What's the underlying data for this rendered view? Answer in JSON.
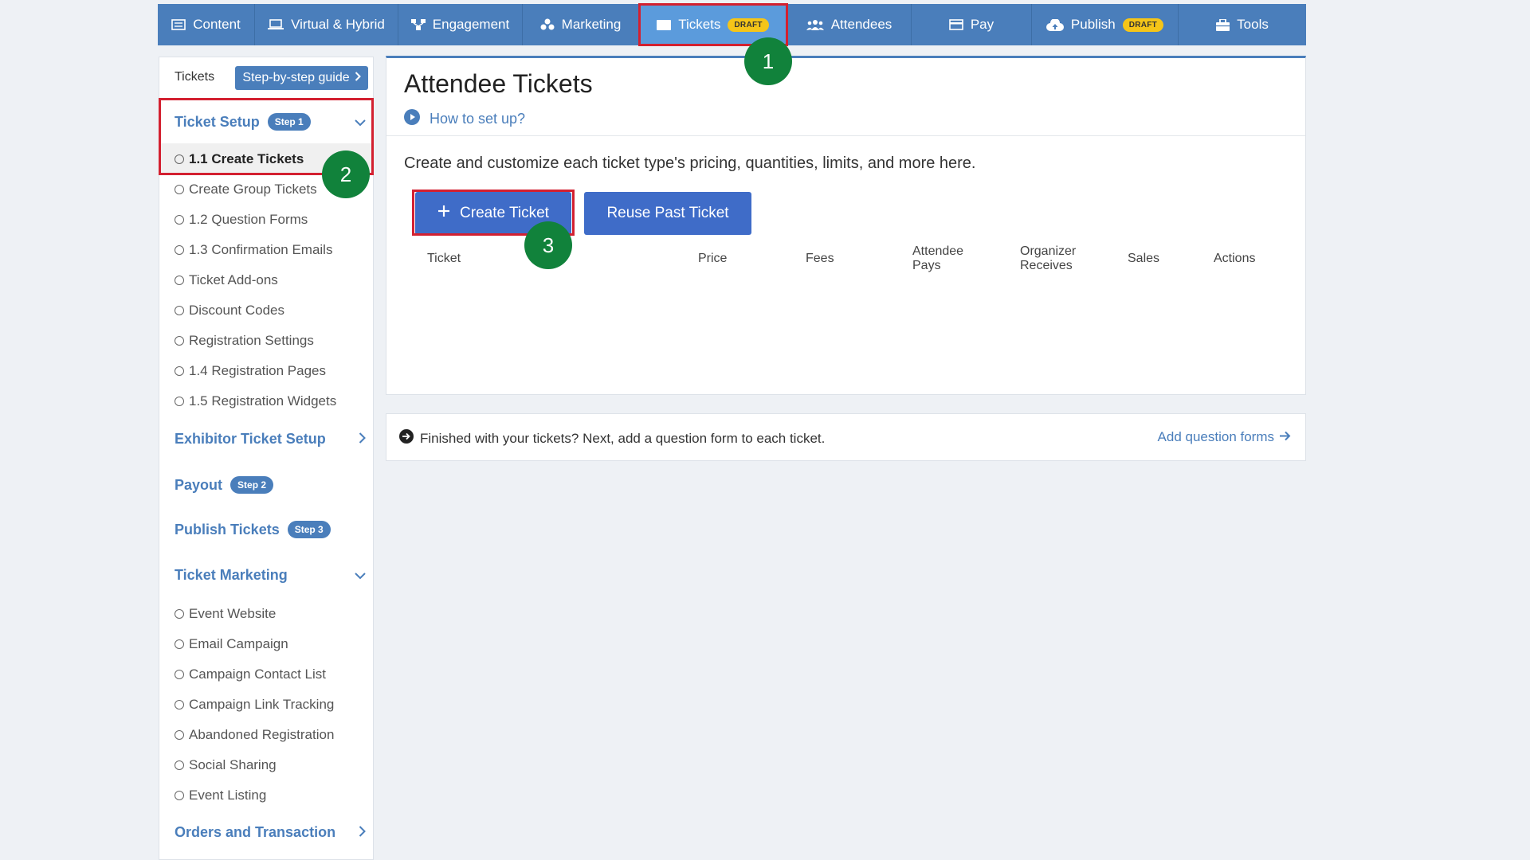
{
  "nav": {
    "items": [
      {
        "label": "Content",
        "icon": "list-icon"
      },
      {
        "label": "Virtual & Hybrid",
        "icon": "laptop-icon"
      },
      {
        "label": "Engagement",
        "icon": "network-icon"
      },
      {
        "label": "Marketing",
        "icon": "bullhorn-icon"
      },
      {
        "label": "Tickets",
        "icon": "ticket-icon",
        "badge": "DRAFT"
      },
      {
        "label": "Attendees",
        "icon": "users-icon"
      },
      {
        "label": "Pay",
        "icon": "card-icon"
      },
      {
        "label": "Publish",
        "icon": "cloud-upload-icon",
        "badge": "DRAFT"
      },
      {
        "label": "Tools",
        "icon": "toolbox-icon"
      }
    ]
  },
  "sidebar": {
    "top_label": "Tickets",
    "guide_button": "Step-by-step guide",
    "sections": {
      "ticket_setup": {
        "label": "Ticket Setup",
        "badge": "Step 1"
      },
      "exhibitor": {
        "label": "Exhibitor Ticket Setup"
      },
      "payout": {
        "label": "Payout",
        "badge": "Step 2"
      },
      "publish": {
        "label": "Publish Tickets",
        "badge": "Step 3"
      },
      "marketing": {
        "label": "Ticket Marketing"
      },
      "orders": {
        "label": "Orders and Transaction"
      }
    },
    "setup_items": [
      "1.1 Create Tickets",
      "Create Group Tickets",
      "1.2 Question Forms",
      "1.3 Confirmation Emails",
      "Ticket Add-ons",
      "Discount Codes",
      "Registration Settings",
      "1.4 Registration Pages",
      "1.5 Registration Widgets"
    ],
    "marketing_items": [
      "Event Website",
      "Email Campaign",
      "Campaign Contact List",
      "Campaign Link Tracking",
      "Abandoned Registration",
      "Social Sharing",
      "Event Listing"
    ]
  },
  "main": {
    "title": "Attendee Tickets",
    "howto": "How to set up?",
    "description": "Create and customize each ticket type's pricing, quantities, limits, and more here.",
    "create_button": "Create Ticket",
    "reuse_button": "Reuse Past Ticket",
    "columns": {
      "ticket": "Ticket",
      "price": "Price",
      "fees": "Fees",
      "attendee_pays_1": "Attendee",
      "attendee_pays_2": "Pays",
      "organizer_1": "Organizer",
      "organizer_2": "Receives",
      "sales": "Sales",
      "actions": "Actions"
    }
  },
  "next": {
    "text": "Finished with your tickets? Next, add a question form to each ticket.",
    "link": "Add question forms"
  },
  "markers": [
    "1",
    "2",
    "3"
  ],
  "colors": {
    "brand": "#4a7ebb",
    "highlight": "#d32030",
    "marker": "#11823b",
    "button": "#3f6cc8",
    "badge": "#f5c518"
  }
}
